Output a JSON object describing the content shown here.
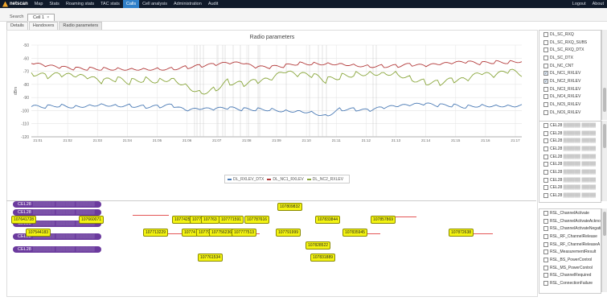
{
  "app": {
    "logo": "netscan",
    "nav": [
      "Map",
      "Stats",
      "Roaming stats",
      "TAC stats",
      "Calls",
      "Cell analysis",
      "Administration",
      "Audit"
    ],
    "active_nav": "Calls",
    "right_nav": [
      "Logout",
      "About"
    ]
  },
  "subbar": {
    "search_label": "Search",
    "cell_tab_label": "Cell 1",
    "cell_tab_close": "×"
  },
  "tabs": [
    "Details",
    "Handovers",
    "Radio parameters"
  ],
  "active_tab": "Radio parameters",
  "chart_data": {
    "type": "line",
    "title": "Radio parameters",
    "ylabel": "dBm",
    "ylim": [
      -120,
      -50
    ],
    "yticks": [
      -50,
      -60,
      -70,
      -80,
      -90,
      -100,
      -110,
      -120
    ],
    "xticks": [
      "21:01",
      "21:02",
      "21:03",
      "21:04",
      "21:05",
      "21:06",
      "21:07",
      "21:08",
      "21:09",
      "21:10",
      "21:11",
      "21:12",
      "21:13",
      "21:14",
      "21:15",
      "21:16",
      "21:17"
    ],
    "grid": true,
    "legend_position": "bottom",
    "series": [
      {
        "name": "DL_RXLEV_DTX",
        "color": "#4a7ab5",
        "values": [
          -97,
          -97,
          -96,
          -97,
          -96,
          -95,
          -96,
          -96,
          -97,
          -97,
          -96,
          -100,
          -99,
          -99,
          -98,
          -99,
          -99,
          -99,
          -100,
          -100,
          -101,
          -104,
          -99,
          -99,
          -100,
          -98,
          -97,
          -96,
          -95,
          -96,
          -96,
          -97,
          -96,
          -96,
          -96,
          -96
        ]
      },
      {
        "name": "DL_NC1_RXLEV",
        "color": "#b33a3a",
        "values": [
          -64,
          -66,
          -67,
          -68,
          -68,
          -68,
          -68,
          -68,
          -68,
          -68,
          -68,
          -67,
          -66,
          -65,
          -64,
          -64,
          -67,
          -67,
          -66,
          -64,
          -64,
          -64,
          -64,
          -65,
          -66,
          -66,
          -66,
          -65,
          -66,
          -65,
          -64,
          -63,
          -64,
          -63,
          -63,
          -62
        ]
      },
      {
        "name": "DL_NC2_RXLEV",
        "color": "#89a63b",
        "values": [
          -71,
          -74,
          -73,
          -74,
          -75,
          -78,
          -76,
          -78,
          -76,
          -77,
          -75,
          -80,
          -86,
          -84,
          -78,
          -80,
          -78,
          -77,
          -71,
          -73,
          -73,
          -77,
          -74,
          -72,
          -71,
          -71,
          -71,
          -75,
          -78,
          -79,
          -77,
          -77,
          -72,
          -74,
          -70,
          -72
        ]
      }
    ]
  },
  "timeline": {
    "cells": [
      {
        "label": "CEL28",
        "blurred": "▒▒▒▒▒▒▒ ▒▒▒▒▒▒ ▒▒▒▒▒▒"
      },
      {
        "label": "CEL28",
        "blurred": "▒▒▒▒▒▒▒ ▒▒▒▒▒▒ ▒▒▒▒▒▒"
      },
      {
        "label": "CEL28",
        "blurred": "▒▒▒▒▒▒▒ ▒▒▒▒▒▒ ▒▒▒▒▒▒"
      },
      {
        "label": "CEL28",
        "blurred": "▒▒▒▒▒▒▒ ▒▒▒▒▒▒ ▒▒▒▒▒▒"
      },
      {
        "label": "CEL28",
        "blurred": "▒▒▒▒▒▒▒ ▒▒▒▒▒▒ ▒▒▒▒▒▒"
      }
    ],
    "events": [
      "107809832",
      "107641728",
      "107660071",
      "1077425",
      "1077",
      "107763",
      "107771591",
      "107787616",
      "107833844",
      "107857869",
      "107544183",
      "107713229",
      "10774",
      "10779",
      "107756236",
      "107777513",
      "107791999",
      "107835945",
      "107872638",
      "107828522",
      "107761534",
      "107831889"
    ]
  },
  "sidebar": {
    "panel1": [
      {
        "label": "DL_SC_RXQ",
        "checked": false
      },
      {
        "label": "DL_SC_RXQ_SUBS",
        "checked": false
      },
      {
        "label": "DL_SC_RXQ_DTX",
        "checked": false
      },
      {
        "label": "DL_SC_DTX",
        "checked": false
      },
      {
        "label": "DL_NC_CNT",
        "checked": false
      },
      {
        "label": "DL_NC1_RXLEV",
        "checked": true
      },
      {
        "label": "DL_NC2_RXLEV",
        "checked": true
      },
      {
        "label": "DL_NC3_RXLEV",
        "checked": false
      },
      {
        "label": "DL_NC4_RXLEV",
        "checked": false
      },
      {
        "label": "DL_NC5_RXLEV",
        "checked": false
      },
      {
        "label": "DL_NC6_RXLEV",
        "checked": false
      }
    ],
    "panel2": [
      {
        "label": "CEL28 ▒▒▒▒▒▒ ▒▒▒▒▒",
        "checked": false
      },
      {
        "label": "CEL28 ▒▒▒▒▒▒ ▒▒▒▒▒",
        "checked": false
      },
      {
        "label": "CEL28 ▒▒▒▒▒▒ ▒▒▒▒▒",
        "checked": false
      },
      {
        "label": "CEL28 ▒▒▒▒▒▒ ▒▒▒▒▒",
        "checked": false
      },
      {
        "label": "CEL28 ▒▒▒▒▒▒ ▒▒▒▒▒",
        "checked": false
      },
      {
        "label": "CEL28 ▒▒▒▒▒▒ ▒▒▒▒▒",
        "checked": false
      },
      {
        "label": "CEL28 ▒▒▒▒▒▒ ▒▒▒▒▒",
        "checked": false
      },
      {
        "label": "CEL28 ▒▒▒▒▒▒ ▒▒▒▒▒",
        "checked": false
      },
      {
        "label": "CEL28 ▒▒▒▒▒▒ ▒▒▒▒▒",
        "checked": false
      },
      {
        "label": "CEL28 ▒▒▒▒▒▒ ▒▒▒▒▒",
        "checked": false
      }
    ],
    "panel3": [
      {
        "label": "RSL_ChannelActivate",
        "checked": false
      },
      {
        "label": "RSL_ChannelActivateAckno",
        "checked": false
      },
      {
        "label": "RSL_ChannelActivateNegati",
        "checked": false
      },
      {
        "label": "RSL_RF_ChannelRelease",
        "checked": false
      },
      {
        "label": "RSL_RF_ChannelReleaseA",
        "checked": false
      },
      {
        "label": "RSL_MeasurementResult",
        "checked": false
      },
      {
        "label": "RSL_BS_PowerControl",
        "checked": false
      },
      {
        "label": "RSL_MS_PowerControl",
        "checked": false
      },
      {
        "label": "RSL_ChannelRequired",
        "checked": false
      },
      {
        "label": "RSL_ConnectionFailure",
        "checked": false
      }
    ]
  }
}
